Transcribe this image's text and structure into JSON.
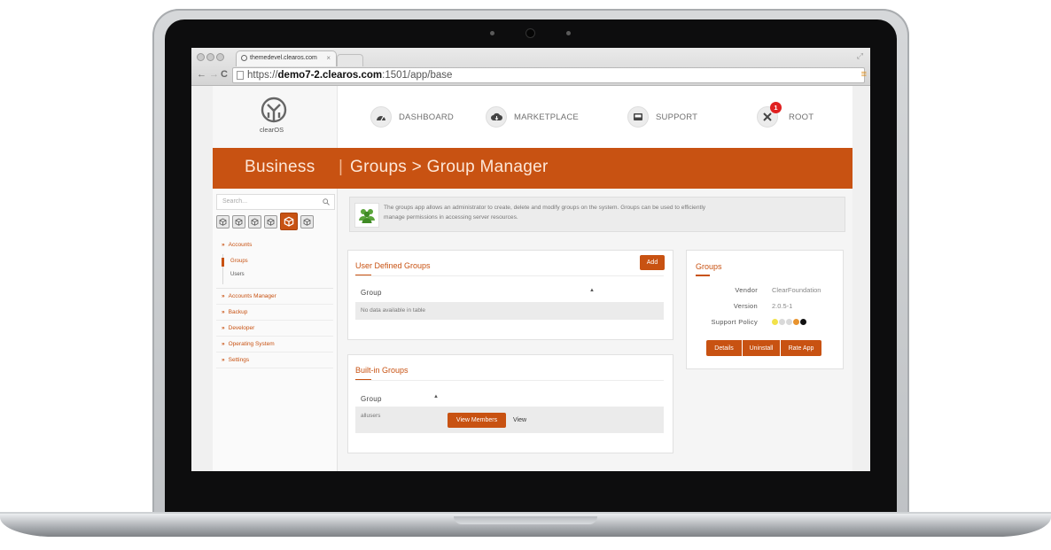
{
  "browser": {
    "tab_title": "themedevel.clearos.com",
    "tab_close": "×",
    "url_prefix": "https://",
    "url_host": "demo7-2.clearos.com",
    "url_port": ":1501",
    "url_path": "/app/base",
    "back": "←",
    "forward": "→",
    "reload": "C",
    "menu_icon": "≡",
    "resize_icon": "⤢"
  },
  "header": {
    "logo_text": "clearOS",
    "nav": [
      {
        "label": "DASHBOARD",
        "icon": "dashboard-gauge-icon"
      },
      {
        "label": "MARKETPLACE",
        "icon": "cloud-download-icon"
      },
      {
        "label": "SUPPORT",
        "icon": "inbox-icon"
      },
      {
        "label": "ROOT",
        "icon": "tools-icon",
        "badge": "1"
      }
    ]
  },
  "banner": {
    "section": "Business",
    "separator": "|",
    "breadcrumb": "Groups > Group Manager"
  },
  "sidebar": {
    "search_placeholder": "Search...",
    "search_icon": "magnifier-icon",
    "category_icons": [
      "cube-icon",
      "cube-icon",
      "cube-icon",
      "cube-icon",
      "cube-icon-active",
      "cube-icon"
    ],
    "accounts": {
      "label": "Accounts",
      "children": [
        "Groups",
        "Users"
      ]
    },
    "menu": [
      {
        "label": "Accounts Manager"
      },
      {
        "label": "Backup"
      },
      {
        "label": "Developer"
      },
      {
        "label": "Operating System"
      },
      {
        "label": "Settings"
      }
    ],
    "chevron": "»"
  },
  "info": {
    "icon": "users-group-icon",
    "text_line1": "The groups app allows an administrator to create, delete and modify groups on the system. Groups can be used to efficiently",
    "text_line2": "manage permissions in accessing server resources."
  },
  "user_groups": {
    "title": "User Defined Groups",
    "add_label": "Add",
    "column": "Group",
    "sort_icon": "▲",
    "empty": "No data available in table"
  },
  "builtin_groups": {
    "title": "Built-in Groups",
    "column": "Group",
    "sort_icon": "▲",
    "rows": [
      {
        "name": "allusers",
        "action_primary": "View Members",
        "action_secondary": "View"
      }
    ]
  },
  "app_info": {
    "title": "Groups",
    "vendor_label": "Vendor",
    "vendor": "ClearFoundation",
    "version_label": "Version",
    "version": "2.0.5-1",
    "support_label": "Support Policy",
    "support_colors": [
      "#f2e24a",
      "#d9d9d9",
      "#d9d9d9",
      "#e8932e",
      "#111111"
    ],
    "buttons": [
      "Details",
      "Uninstall",
      "Rate App"
    ]
  },
  "colors": {
    "accent": "#c85212",
    "badge": "#e02020"
  }
}
